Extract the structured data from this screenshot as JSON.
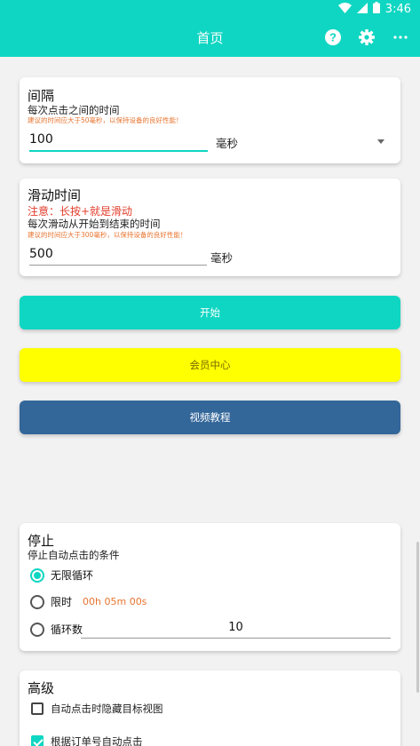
{
  "status_bar": {
    "time": "3:46"
  },
  "app_bar": {
    "title": "首页"
  },
  "interval_card": {
    "title": "间隔",
    "subtitle": "每次点击之间的时间",
    "tip": "建议的时间应大于50毫秒，以保持设备的良好性能！",
    "value": "100",
    "unit": "毫秒"
  },
  "swipe_card": {
    "title": "滑动时间",
    "note": "注意：长按+就是滑动",
    "subtitle": "每次滑动从开始到结束的时间",
    "tip": "建议的时间应大于300毫秒，以保持设备的良好性能！",
    "value": "500",
    "unit": "毫秒"
  },
  "buttons": {
    "start": "开始",
    "member": "会员中心",
    "video": "视频教程"
  },
  "stop_card": {
    "title": "停止",
    "subtitle": "停止自动点击的条件",
    "options": {
      "infinite": "无限循环",
      "time_limit": "限时",
      "time_value": "00h 05m 00s",
      "loop_count": "循环数",
      "loop_value": "10"
    }
  },
  "advanced_card": {
    "title": "高级",
    "hide_view": "自动点击时隐藏目标视图",
    "auto_click_order": "根据订单号自动点击"
  },
  "colors": {
    "accent": "#0fd6c2",
    "member_bg": "#ffff00",
    "video_bg": "#336699",
    "warn": "#e23b2a",
    "tip": "#e8742f"
  }
}
